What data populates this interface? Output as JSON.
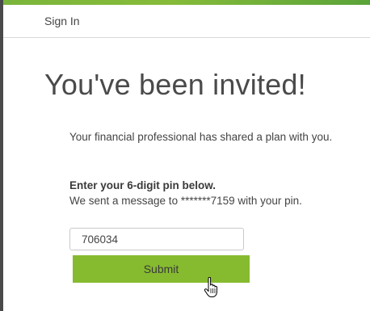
{
  "header": {
    "sign_in_label": "Sign In"
  },
  "main": {
    "title": "You've been invited!",
    "shared_message": "Your financial professional has shared a plan with you.",
    "pin_heading": "Enter your 6-digit pin below.",
    "pin_subtext": "We sent a message to *******7159 with your pin.",
    "pin_value": "706034",
    "submit_label": "Submit"
  },
  "colors": {
    "accent_green": "#86bb2f",
    "top_bar_green": "#7ab53b"
  },
  "icons": {
    "cursor": "hand-pointer-icon"
  }
}
